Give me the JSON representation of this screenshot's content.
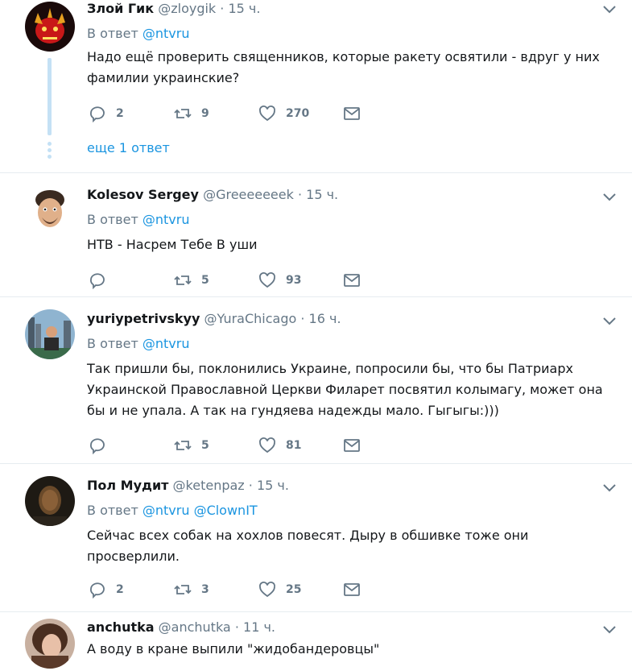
{
  "tweets": [
    {
      "name": "Злой Гик",
      "handle": "@zloygik",
      "dot": "·",
      "time": "15 ч.",
      "reply_prefix": "В ответ",
      "mentions": [
        "@ntvru"
      ],
      "text": "Надо ещё проверить священников, которые ракету освятили - вдруг у них фамилии украинские?",
      "replies": "2",
      "retweets": "9",
      "likes": "270",
      "more_replies": "еще 1 ответ"
    },
    {
      "name": "Kolesov Sergey",
      "handle": "@Greeeeeeek",
      "dot": "·",
      "time": "15 ч.",
      "reply_prefix": "В ответ",
      "mentions": [
        "@ntvru"
      ],
      "text": "НТВ - Насрем Тебе В уши",
      "replies": "",
      "retweets": "5",
      "likes": "93"
    },
    {
      "name": "yuriypetrivskyy",
      "handle": "@YuraChicago",
      "dot": "·",
      "time": "16 ч.",
      "reply_prefix": "В ответ",
      "mentions": [
        "@ntvru"
      ],
      "text": "Так пришли бы, поклонились Украине, попросили бы, что бы Патриарх Украинской Православной Церкви Филарет посвятил колымагу, может она бы и не упала. А так на гундяева надежды мало. Гыгыгы:)))",
      "replies": "",
      "retweets": "5",
      "likes": "81"
    },
    {
      "name": "Пол Мудит",
      "handle": "@ketenpaz",
      "dot": "·",
      "time": "15 ч.",
      "reply_prefix": "В ответ",
      "mentions": [
        "@ntvru",
        "@ClownIT"
      ],
      "text": "Сейчас всех собак на хохлов повесят. Дыру в обшивке тоже они просверлили.",
      "replies": "2",
      "retweets": "3",
      "likes": "25"
    },
    {
      "name": "anchutka",
      "handle": "@anchutka",
      "dot": "·",
      "time": "11 ч.",
      "text": "А воду в кране выпили \"жидобандеровцы\""
    }
  ],
  "icons": {
    "reply": "reply-icon",
    "retweet": "retweet-icon",
    "like": "heart-icon",
    "dm": "envelope-icon",
    "caret": "chevron-down-icon"
  },
  "colors": {
    "link": "#1b95e0",
    "muted": "#657786",
    "thread": "#c4e1f5",
    "divider": "#e6ecf0"
  }
}
